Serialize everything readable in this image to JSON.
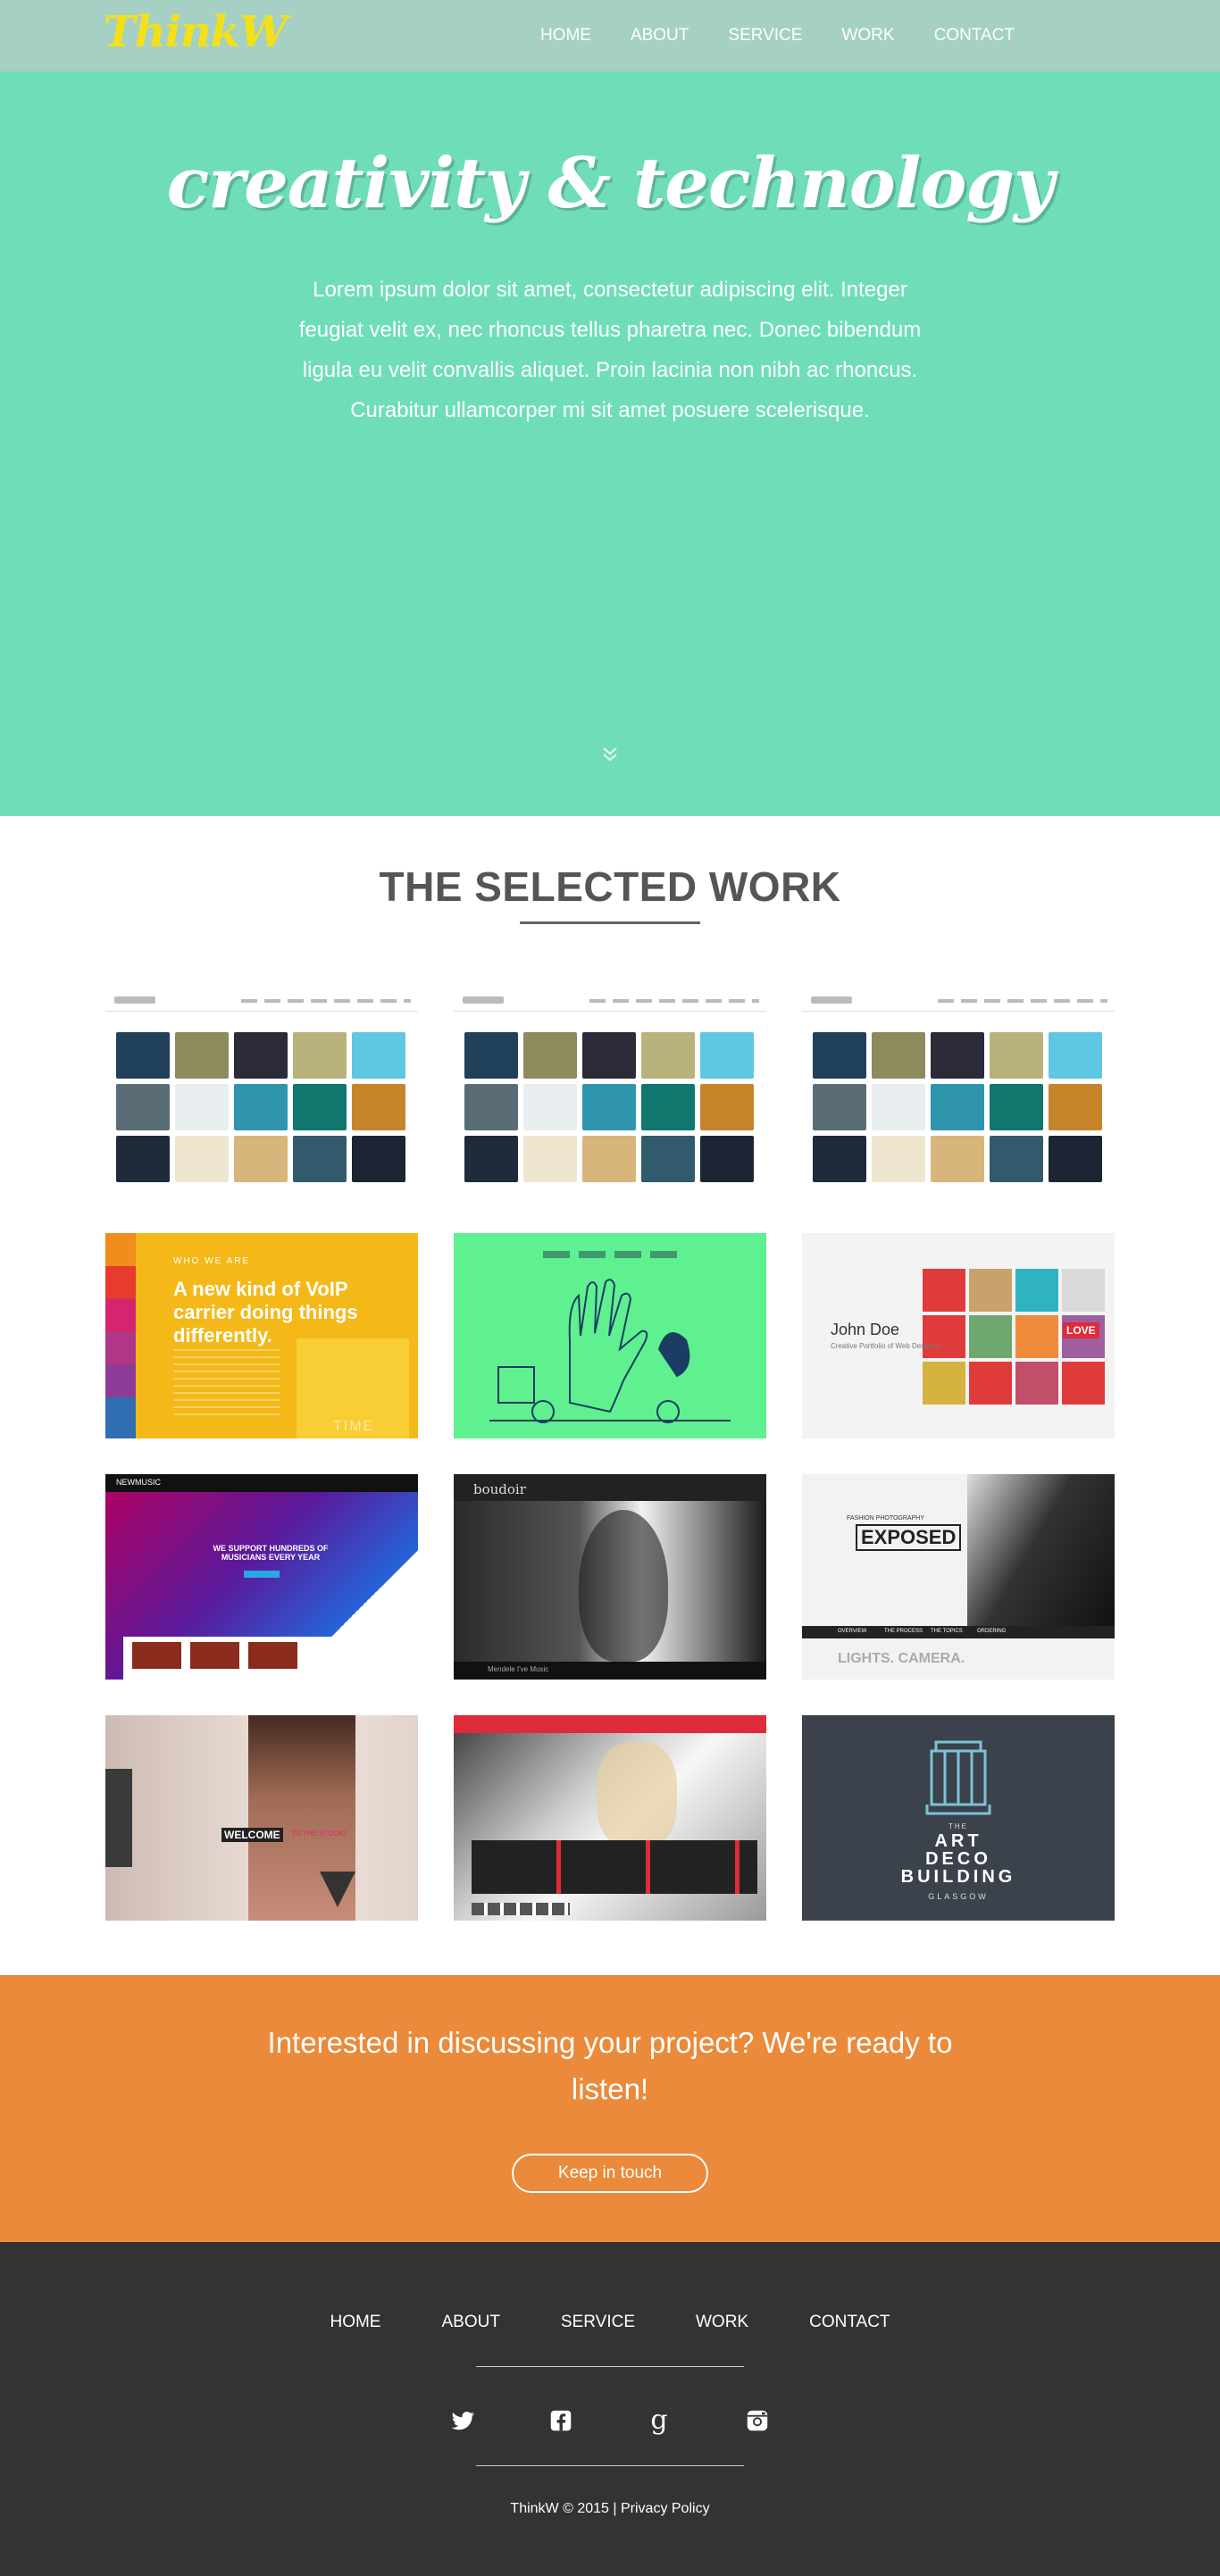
{
  "brand": {
    "logo": "ThinkW"
  },
  "nav": {
    "items": [
      "HOME",
      "ABOUT",
      "SERVICE",
      "WORK",
      "CONTACT"
    ]
  },
  "hero": {
    "title": "creativity & technology",
    "text": "Lorem ipsum dolor sit amet, consectetur adipiscing elit. Integer feugiat velit ex, nec rhoncus tellus pharetra nec. Donec bibendum ligula eu velit convallis aliquet. Proin lacinia non nibh ac rhoncus. Curabitur ullamcorper mi sit amet posuere scelerisque.",
    "scroll_icon": "double-chevron-down-icon"
  },
  "work": {
    "heading": "THE SELECTED WORK",
    "tiles": [
      {
        "name": "gallery-grid-project",
        "kind": "gallery"
      },
      {
        "name": "gallery-grid-project",
        "kind": "gallery"
      },
      {
        "name": "gallery-grid-project",
        "kind": "gallery"
      },
      {
        "name": "voip-carrier-project",
        "kind": "voip",
        "label": "WHO WE ARE",
        "headline": "A new kind of VoIP carrier doing things differently.",
        "time": "TIME"
      },
      {
        "name": "hand-illustration-project",
        "kind": "hand"
      },
      {
        "name": "john-doe-portfolio-project",
        "kind": "johndoe",
        "title": "John Doe",
        "subtitle": "Creative Portfolio of Web Designer",
        "love": "LOVE"
      },
      {
        "name": "newmusic-project",
        "kind": "music",
        "brand": "NEWMUSIC",
        "headline": "WE SUPPORT HUNDREDS OF MUSICIANS EVERY YEAR"
      },
      {
        "name": "boudoir-project",
        "kind": "boudoir",
        "brand": "boudoir",
        "caption": "Mendele I've Music"
      },
      {
        "name": "exposed-photography-project",
        "kind": "exposed",
        "kicker": "FASHION PHOTOGRAPHY",
        "title": "EXPOSED",
        "tagline": "LIGHTS. CAMERA.",
        "tabs": [
          "OVERVIEW",
          "THE PROCESS",
          "THE TOPICS",
          "ORDERING"
        ]
      },
      {
        "name": "welcome-fashion-project",
        "kind": "welcome",
        "label": "WELCOME",
        "accent": "TO THE STUDIO"
      },
      {
        "name": "fashion-gallery-project",
        "kind": "fashion"
      },
      {
        "name": "art-deco-building-project",
        "kind": "artdeco",
        "small": "THE",
        "lines": [
          "ART",
          "DECO",
          "BUILDING"
        ],
        "city": "GLASGOW"
      }
    ]
  },
  "cta": {
    "text": "Interested in discussing your project? We're ready to listen!",
    "button": "Keep in touch"
  },
  "footer": {
    "nav": [
      "HOME",
      "ABOUT",
      "SERVICE",
      "WORK",
      "CONTACT"
    ],
    "social": [
      {
        "name": "twitter-icon",
        "glyph": "🐦"
      },
      {
        "name": "facebook-icon",
        "glyph": "f"
      },
      {
        "name": "google-plus-icon",
        "glyph": "g"
      },
      {
        "name": "instagram-icon",
        "glyph": "◙"
      }
    ],
    "copyright": "ThinkW © 2015 |",
    "privacy": "Privacy Policy"
  },
  "colors": {
    "nav": "#a6d0c3",
    "hero": "#6fddba",
    "logo": "#f4e01a",
    "cta": "#ea8a3a",
    "footer": "#343234"
  }
}
